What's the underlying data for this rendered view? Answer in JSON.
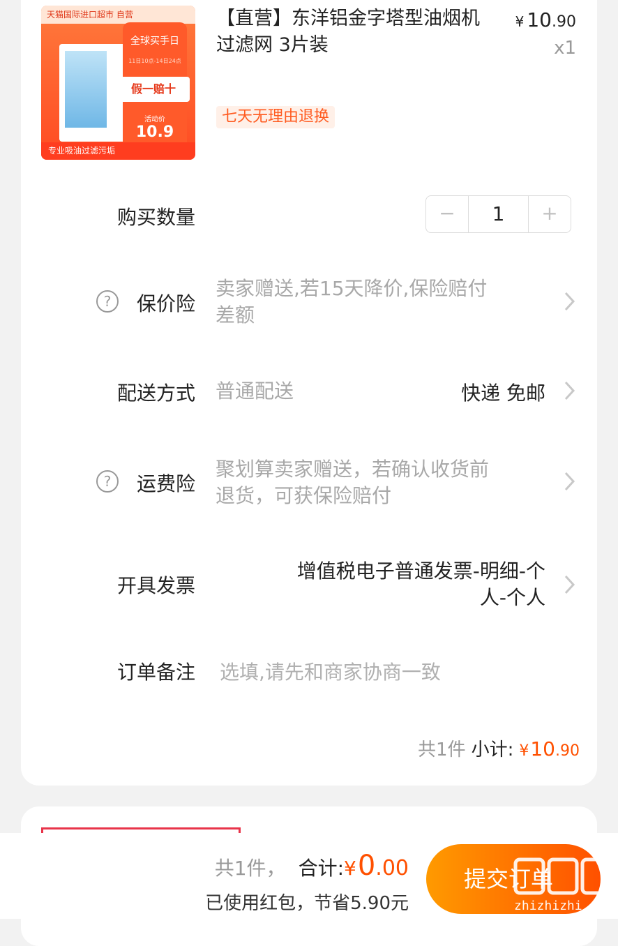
{
  "product": {
    "image": {
      "top_banner": "天猫国际进口超市 自营",
      "promo_title": "全球买手日",
      "promo_date": "11日10点-14日24点",
      "promo_tag": "假一赔十",
      "promo_price_label": "活动价",
      "promo_price": "10.9",
      "bottom_text": "专业吸油过滤污垢"
    },
    "title": "【直营】东洋铝金字塔型油烟机过滤网 3片装",
    "price_symbol": "¥",
    "price_int": "10",
    "price_dec": ".90",
    "quantity_badge": "x1",
    "return_tag": "七天无理由退换"
  },
  "rows": {
    "quantity": {
      "label": "购买数量",
      "minus": "−",
      "value": "1",
      "plus": "+"
    },
    "price_protection": {
      "label": "保价险",
      "value_line1": "卖家赠送,若15天降价,保险赔付",
      "value_line2": "差额"
    },
    "delivery": {
      "label": "配送方式",
      "value": "普通配送",
      "detail": "快递 免邮"
    },
    "shipping_insurance": {
      "label": "运费险",
      "value_line1": "聚划算卖家赠送，若确认收货前",
      "value_line2": "退货，可获保险赔付"
    },
    "invoice": {
      "label": "开具发票",
      "value_line1": "增值税电子普通发票-明细-个",
      "value_line2": "人-个人"
    },
    "note": {
      "label": "订单备注",
      "placeholder": "选填,请先和商家协商一致"
    }
  },
  "subtotal": {
    "count": "共1件",
    "label": "小计:",
    "symbol": "¥",
    "int": "10",
    "dec": ".90"
  },
  "footer": {
    "count": "共1件，",
    "label": "合计:",
    "symbol": "¥",
    "int": "0",
    "dec": ".00",
    "saved": "已使用红包，节省5.90元",
    "submit": "提交订单"
  },
  "watermark": {
    "text": "zhizhizhi.com"
  },
  "colors": {
    "accent": "#ff5000",
    "button_start": "#ff9a00",
    "button_end": "#ff5000"
  }
}
